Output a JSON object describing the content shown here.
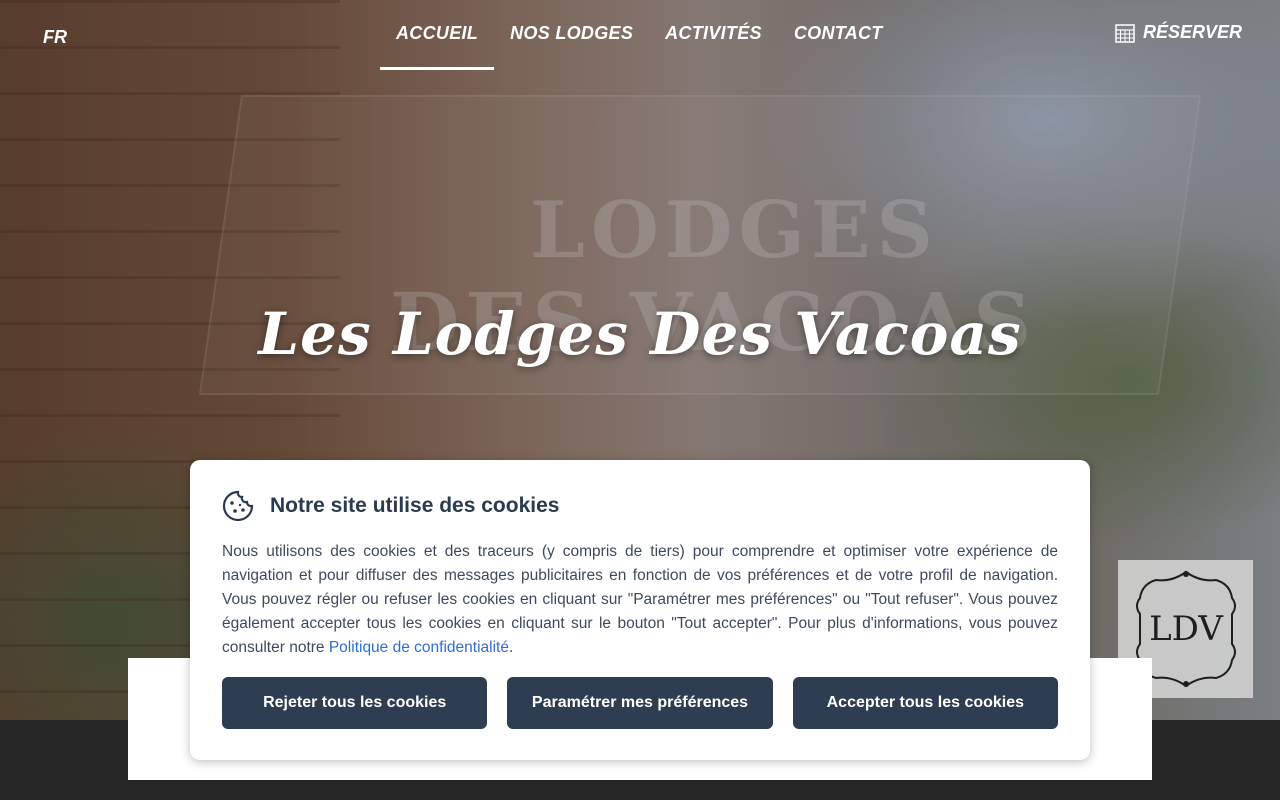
{
  "header": {
    "language": "FR",
    "nav": [
      {
        "label": "ACCUEIL",
        "active": true
      },
      {
        "label": "NOS LODGES",
        "active": false
      },
      {
        "label": "ACTIVITÉS",
        "active": false
      },
      {
        "label": "CONTACT",
        "active": false
      }
    ],
    "reserve_label": "RÉSERVER",
    "reserve_icon": "calendar-icon"
  },
  "hero": {
    "title": "Les Lodges Des Vacoas",
    "sign_text_top": "LODGES",
    "sign_text_bottom": "DES VACOAS"
  },
  "logo": {
    "text": "LDV"
  },
  "cookie_banner": {
    "icon": "cookie-icon",
    "title": "Notre site utilise des cookies",
    "body": "Nous utilisons des cookies et des traceurs (y compris de tiers) pour comprendre et optimiser votre expérience de navigation et pour diffuser des messages publicitaires en fonction de vos préférences et de votre profil de navigation. Vous pouvez régler ou refuser les cookies en cliquant sur \"Paramétrer mes préférences\" ou \"Tout refuser\". Vous pouvez également accepter tous les cookies en cliquant sur le bouton \"Tout accepter\". Pour plus d'informations, vous pouvez consulter notre ",
    "policy_link": "Politique de confidentialité",
    "body_end": ".",
    "buttons": {
      "reject": "Rejeter tous les cookies",
      "settings": "Paramétrer mes préférences",
      "accept": "Accepter tous les cookies"
    }
  },
  "colors": {
    "button_bg": "#2e3d51",
    "title_text": "#2b3a4f",
    "link": "#2f6fd6"
  }
}
